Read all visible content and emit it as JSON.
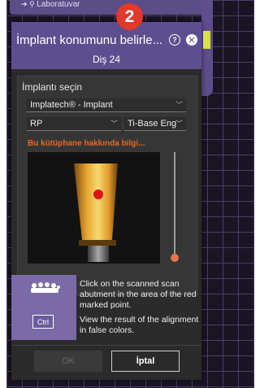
{
  "background": {
    "behind_tab_label": "Laboratuvar"
  },
  "step_badge": "2",
  "dialog": {
    "title": "İmplant konumunu belirle...",
    "subtitle": "Diş 24",
    "help_icon": "question-circle-icon",
    "close_icon": "close-circle-icon",
    "section_label": "İmplantı seçin",
    "implant_select": {
      "value": "Implatech® - Implant"
    },
    "type_select": {
      "value": "RP"
    },
    "base_select": {
      "value": "Ti-Base Eng"
    },
    "library_link": "Bu kütüphane hakkında bilgi...",
    "zoom_slider": {
      "value_percent": 5
    },
    "instructions": {
      "line1": "Click on the scanned scan abutment in the area of the red marked point.",
      "line2": "View the result of the alignment in false colors.",
      "key_label": "Ctrl"
    },
    "buttons": {
      "ok": "OK",
      "cancel": "İptal"
    }
  },
  "colors": {
    "title_bar": "#5d4f8f",
    "badge": "#e03a2b",
    "link": "#e26a24",
    "marker": "#e0101a"
  }
}
